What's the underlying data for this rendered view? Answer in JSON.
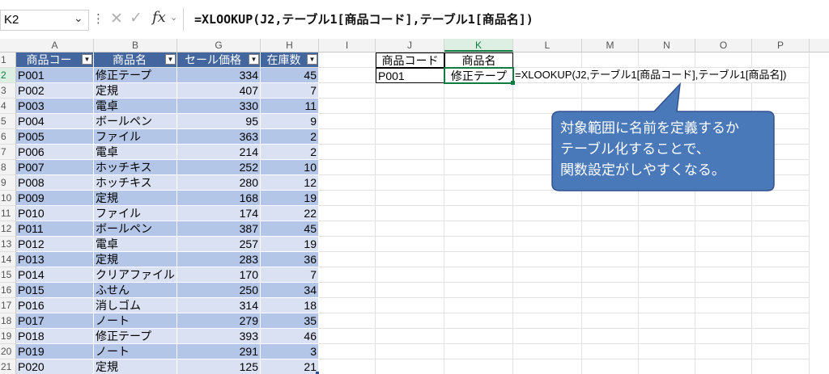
{
  "formula_bar": {
    "name_box": "K2",
    "formula": "=XLOOKUP(J2,テーブル1[商品コード],テーブル1[商品名])"
  },
  "columns": [
    "A",
    "B",
    "G",
    "H",
    "I",
    "J",
    "K",
    "L",
    "M",
    "N",
    "O",
    "P"
  ],
  "rows": [
    "1",
    "2",
    "3",
    "4",
    "5",
    "6",
    "7",
    "8",
    "9",
    "10",
    "11",
    "12",
    "13",
    "14",
    "15",
    "16",
    "17",
    "18",
    "19",
    "20",
    "21"
  ],
  "table": {
    "headers": [
      "商品コー",
      "商品名",
      "セール価格",
      "在庫数"
    ],
    "rows": [
      [
        "P001",
        "修正テープ",
        "334",
        "45"
      ],
      [
        "P002",
        "定規",
        "407",
        "7"
      ],
      [
        "P003",
        "電卓",
        "330",
        "11"
      ],
      [
        "P004",
        "ボールペン",
        "95",
        "9"
      ],
      [
        "P005",
        "ファイル",
        "363",
        "2"
      ],
      [
        "P006",
        "電卓",
        "214",
        "2"
      ],
      [
        "P007",
        "ホッチキス",
        "252",
        "10"
      ],
      [
        "P008",
        "ホッチキス",
        "280",
        "12"
      ],
      [
        "P009",
        "定規",
        "168",
        "19"
      ],
      [
        "P010",
        "ファイル",
        "174",
        "22"
      ],
      [
        "P011",
        "ボールペン",
        "387",
        "45"
      ],
      [
        "P012",
        "電卓",
        "257",
        "19"
      ],
      [
        "P013",
        "定規",
        "283",
        "36"
      ],
      [
        "P014",
        "クリアファイル",
        "170",
        "7"
      ],
      [
        "P015",
        "ふせん",
        "250",
        "34"
      ],
      [
        "P016",
        "消しゴム",
        "314",
        "18"
      ],
      [
        "P017",
        "ノート",
        "279",
        "35"
      ],
      [
        "P018",
        "修正テープ",
        "393",
        "46"
      ],
      [
        "P019",
        "ノート",
        "291",
        "3"
      ],
      [
        "P020",
        "定規",
        "125",
        "21"
      ]
    ]
  },
  "lookup": {
    "header_code": "商品コード",
    "header_name": "商品名",
    "code": "P001",
    "name": "修正テープ",
    "formula_text": "=XLOOKUP(J2,テーブル1[商品コード],テーブル1[商品名])"
  },
  "callout": {
    "lines": [
      "対象範囲に名前を定義するか",
      "テーブル化することで、",
      "関数設定がしやすくなる。"
    ],
    "fill": "#4a79b9",
    "stroke": "#2f528f"
  },
  "colors": {
    "table_header": "#44669e",
    "band_dark": "#b4c6e7",
    "band_light": "#d9e1f2",
    "selection": "#107c41"
  }
}
